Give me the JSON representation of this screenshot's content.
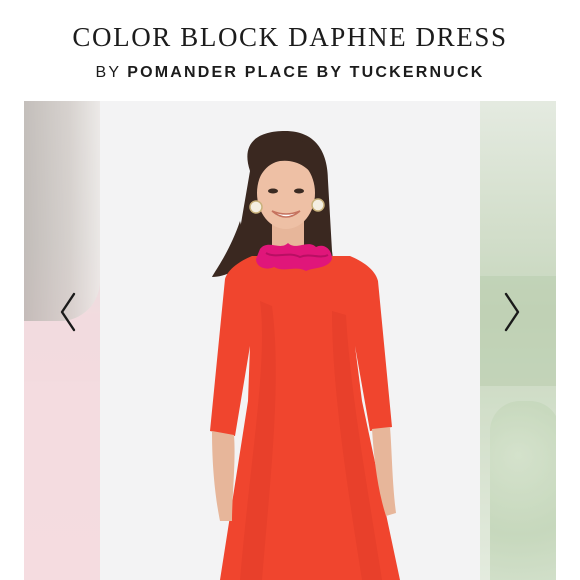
{
  "product": {
    "title": "COLOR BLOCK DAPHNE DRESS",
    "by_label": "BY",
    "brand": "POMANDER PLACE BY TUCKERNUCK"
  },
  "carousel": {
    "prev_icon": "chevron-left-icon",
    "next_icon": "chevron-right-icon",
    "main_image": "model-in-red-dress-with-pink-collar"
  },
  "colors": {
    "dress": "#f0452e",
    "collar": "#e0167a",
    "text": "#1c1c1c"
  }
}
